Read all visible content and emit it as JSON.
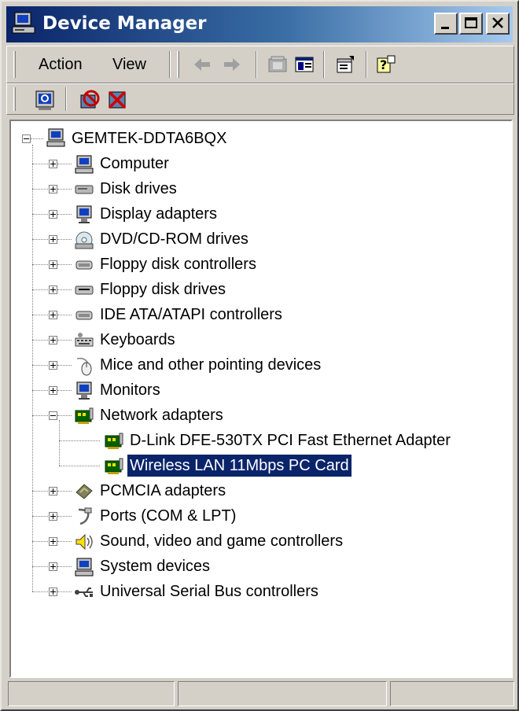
{
  "window": {
    "title": "Device Manager",
    "title_icon": "device-manager-icon"
  },
  "menu": [
    "Action",
    "View"
  ],
  "toolbar": {
    "standard_icons": [
      "back-arrow-icon",
      "forward-arrow-icon",
      "up-folder-icon",
      "show-hide-tree-icon",
      "properties-icon",
      "help-icon"
    ],
    "device_icons": [
      "scan-hardware-icon",
      "disable-device-icon",
      "uninstall-device-icon"
    ]
  },
  "tree": {
    "root": "GEMTEK-DDTA6BQX",
    "categories": [
      {
        "label": "Computer",
        "icon": "computer-icon",
        "expanded": false
      },
      {
        "label": "Disk drives",
        "icon": "disk-drive-icon",
        "expanded": false
      },
      {
        "label": "Display adapters",
        "icon": "display-adapter-icon",
        "expanded": false
      },
      {
        "label": "DVD/CD-ROM drives",
        "icon": "cd-rom-icon",
        "expanded": false
      },
      {
        "label": "Floppy disk controllers",
        "icon": "controller-icon",
        "expanded": false
      },
      {
        "label": "Floppy disk drives",
        "icon": "floppy-drive-icon",
        "expanded": false
      },
      {
        "label": "IDE ATA/ATAPI controllers",
        "icon": "controller-icon",
        "expanded": false
      },
      {
        "label": "Keyboards",
        "icon": "keyboard-icon",
        "expanded": false
      },
      {
        "label": "Mice and other pointing devices",
        "icon": "mouse-icon",
        "expanded": false
      },
      {
        "label": "Monitors",
        "icon": "monitor-icon",
        "expanded": false
      },
      {
        "label": "Network adapters",
        "icon": "network-adapter-icon",
        "expanded": true,
        "children": [
          {
            "label": "D-Link DFE-530TX PCI Fast Ethernet Adapter",
            "icon": "network-adapter-icon",
            "selected": false
          },
          {
            "label": "Wireless LAN 11Mbps PC Card",
            "icon": "network-adapter-icon",
            "selected": true
          }
        ]
      },
      {
        "label": "PCMCIA adapters",
        "icon": "pcmcia-icon",
        "expanded": false
      },
      {
        "label": "Ports (COM & LPT)",
        "icon": "port-icon",
        "expanded": false
      },
      {
        "label": "Sound, video and game controllers",
        "icon": "sound-icon",
        "expanded": false
      },
      {
        "label": "System devices",
        "icon": "computer-icon",
        "expanded": false
      },
      {
        "label": "Universal Serial Bus controllers",
        "icon": "usb-icon",
        "expanded": false
      }
    ]
  },
  "colors": {
    "title_start": "#0a246a",
    "title_end": "#a6caf0",
    "face": "#d4d0c8",
    "selection": "#0a246a"
  }
}
